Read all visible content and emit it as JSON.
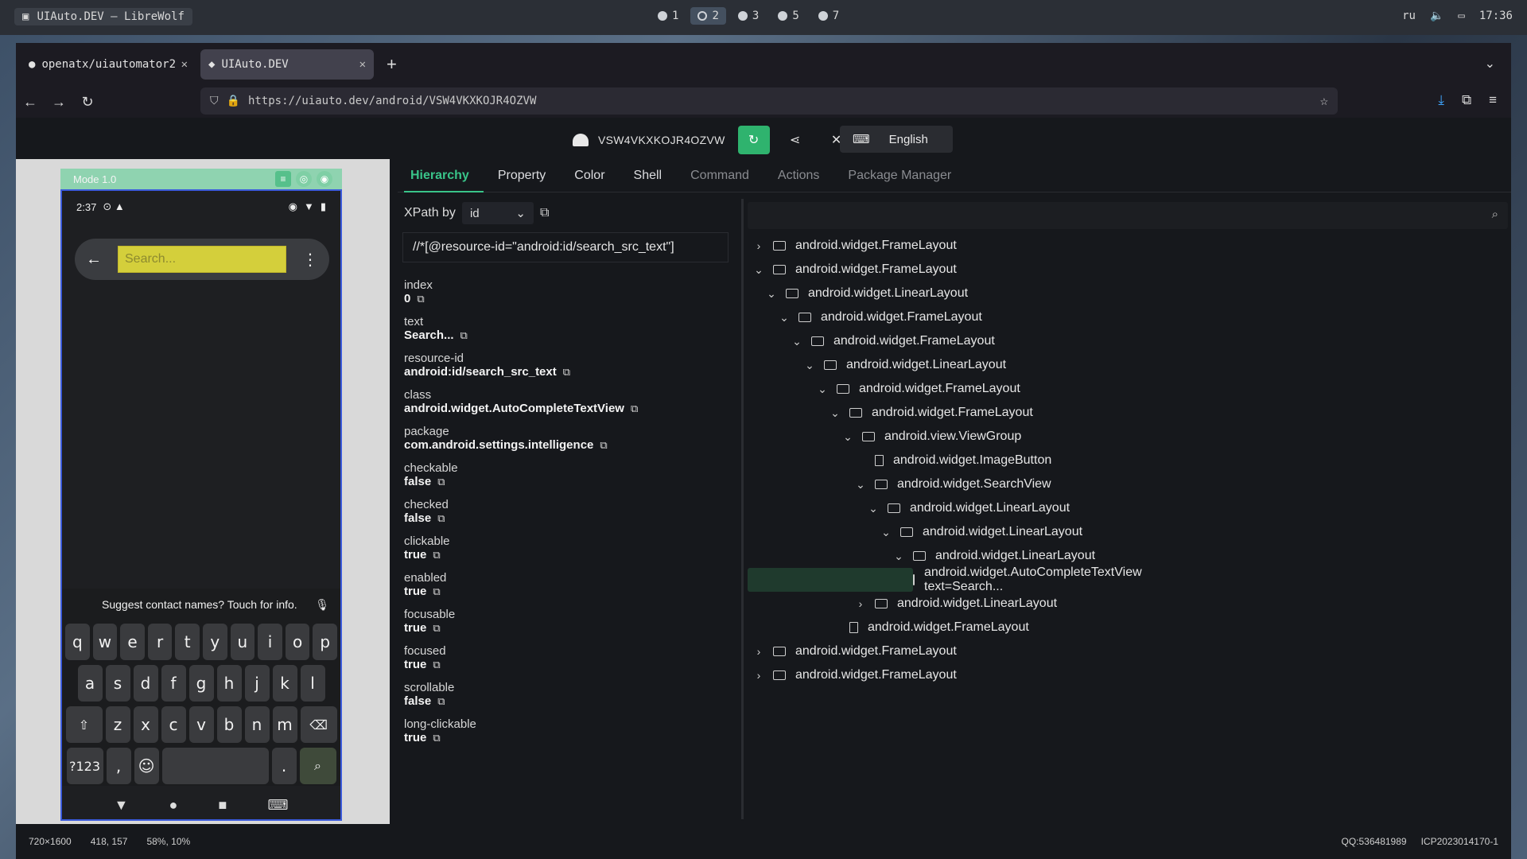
{
  "system": {
    "window_title": "UIAuto.DEV — LibreWolf",
    "workspaces": [
      "1",
      "2",
      "3",
      "5",
      "7"
    ],
    "active_workspace": "2",
    "lang": "ru",
    "time": "17:36"
  },
  "browser": {
    "tabs": [
      {
        "label": "openatx/uiautomator2"
      },
      {
        "label": "UIAuto.DEV"
      }
    ],
    "url": "https://uiauto.dev/android/VSW4VKXKOJR4OZVW"
  },
  "devbar": {
    "serial": "VSW4VKXKOJR4OZVW",
    "language": "English"
  },
  "phone_panel": {
    "mode_label": "Mode 1.0",
    "status_time": "2:37",
    "search_placeholder": "Search...",
    "suggestion": "Suggest contact names? Touch for info.",
    "keyboard": {
      "row1": [
        "q",
        "w",
        "e",
        "r",
        "t",
        "y",
        "u",
        "i",
        "o",
        "p"
      ],
      "row2": [
        "a",
        "s",
        "d",
        "f",
        "g",
        "h",
        "j",
        "k",
        "l"
      ],
      "row3": [
        "z",
        "x",
        "c",
        "v",
        "b",
        "n",
        "m"
      ],
      "row4_left": "?123",
      "row4_comma": ",",
      "row4_period": "."
    }
  },
  "tabs": {
    "hierarchy": "Hierarchy",
    "property": "Property",
    "color": "Color",
    "shell": "Shell",
    "command": "Command",
    "actions": "Actions",
    "package_manager": "Package Manager"
  },
  "xpath": {
    "label": "XPath by",
    "mode": "id",
    "value": "//*[@resource-id=\"android:id/search_src_text\"]"
  },
  "properties": [
    {
      "key": "index",
      "value": "0"
    },
    {
      "key": "text",
      "value": "Search..."
    },
    {
      "key": "resource-id",
      "value": "android:id/search_src_text"
    },
    {
      "key": "class",
      "value": "android.widget.AutoCompleteTextView"
    },
    {
      "key": "package",
      "value": "com.android.settings.intelligence"
    },
    {
      "key": "checkable",
      "value": "false"
    },
    {
      "key": "checked",
      "value": "false"
    },
    {
      "key": "clickable",
      "value": "true"
    },
    {
      "key": "enabled",
      "value": "true"
    },
    {
      "key": "focusable",
      "value": "true"
    },
    {
      "key": "focused",
      "value": "true"
    },
    {
      "key": "scrollable",
      "value": "false"
    },
    {
      "key": "long-clickable",
      "value": "true"
    }
  ],
  "tree": [
    {
      "label": "android.widget.FrameLayout",
      "depth": 0,
      "state": "collapsed"
    },
    {
      "label": "android.widget.FrameLayout",
      "depth": 0,
      "state": "expanded"
    },
    {
      "label": "android.widget.LinearLayout",
      "depth": 1,
      "state": "expanded"
    },
    {
      "label": "android.widget.FrameLayout",
      "depth": 2,
      "state": "expanded"
    },
    {
      "label": "android.widget.FrameLayout",
      "depth": 3,
      "state": "expanded"
    },
    {
      "label": "android.widget.LinearLayout",
      "depth": 4,
      "state": "expanded"
    },
    {
      "label": "android.widget.FrameLayout",
      "depth": 5,
      "state": "expanded"
    },
    {
      "label": "android.widget.FrameLayout",
      "depth": 6,
      "state": "expanded"
    },
    {
      "label": "android.view.ViewGroup",
      "depth": 7,
      "state": "expanded"
    },
    {
      "label": "android.widget.ImageButton",
      "depth": 8,
      "state": "leaf"
    },
    {
      "label": "android.widget.SearchView",
      "depth": 8,
      "state": "expanded"
    },
    {
      "label": "android.widget.LinearLayout",
      "depth": 9,
      "state": "expanded"
    },
    {
      "label": "android.widget.LinearLayout",
      "depth": 10,
      "state": "expanded"
    },
    {
      "label": "android.widget.LinearLayout",
      "depth": 11,
      "state": "expanded"
    },
    {
      "label": "android.widget.AutoCompleteTextView text=Search...",
      "depth": 12,
      "state": "leaf",
      "selected": true
    },
    {
      "label": "android.widget.LinearLayout",
      "depth": 8,
      "state": "collapsed"
    },
    {
      "label": "android.widget.FrameLayout",
      "depth": 6,
      "state": "leaf"
    },
    {
      "label": "android.widget.FrameLayout",
      "depth": 0,
      "state": "collapsed"
    },
    {
      "label": "android.widget.FrameLayout",
      "depth": 0,
      "state": "collapsed"
    }
  ],
  "footer": {
    "resolution": "720×1600",
    "coords": "418, 157",
    "percent": "58%, 10%",
    "qq": "QQ:536481989",
    "icp": "ICP2023014170-1"
  }
}
